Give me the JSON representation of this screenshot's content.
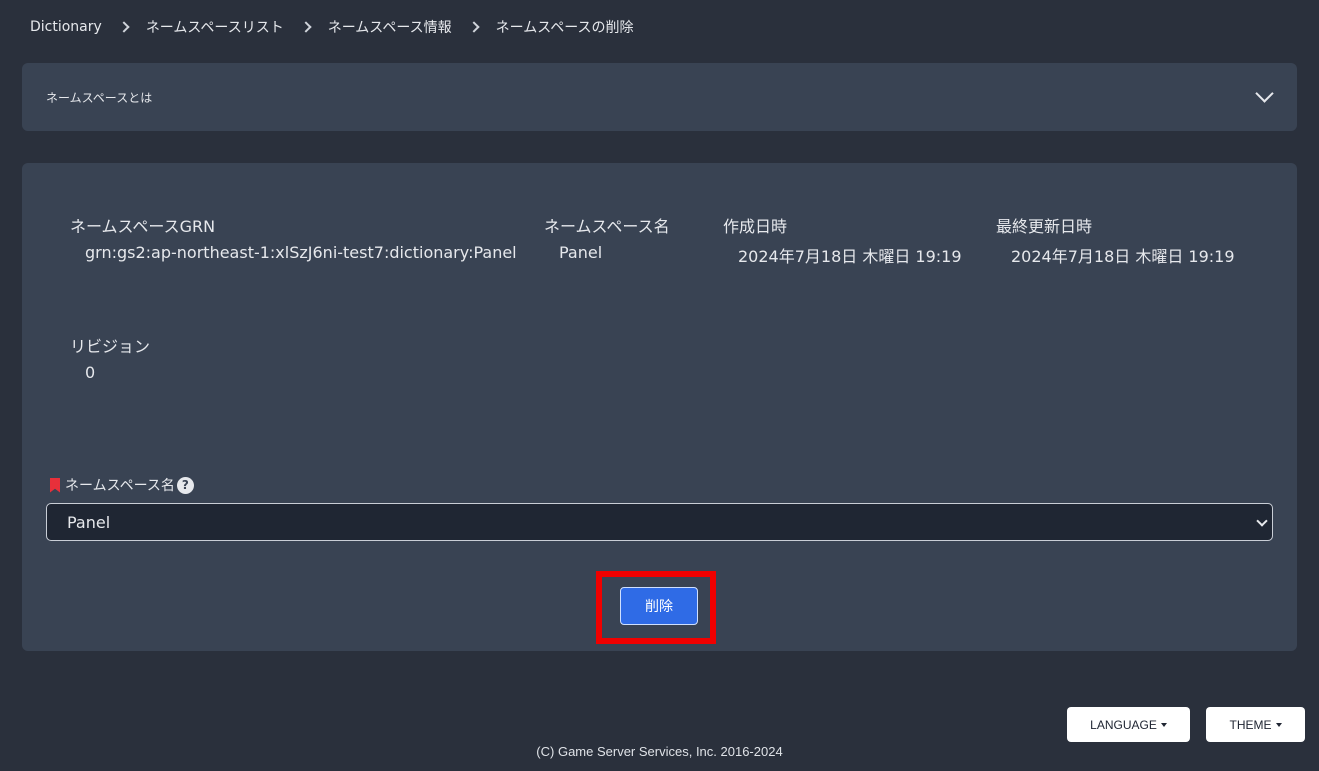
{
  "breadcrumb": {
    "items": [
      "Dictionary",
      "ネームスペースリスト",
      "ネームスペース情報",
      "ネームスペースの削除"
    ]
  },
  "about_panel": {
    "title": "ネームスペースとは",
    "expand_icon": "chevron-down-icon"
  },
  "details": {
    "grn_label": "ネームスペースGRN",
    "grn_value": "grn:gs2:ap-northeast-1:xlSzJ6ni-test7:dictionary:Panel",
    "name_label": "ネームスペース名",
    "name_value": "Panel",
    "created_label": "作成日時",
    "created_value": "2024年7月18日 木曜日 19:19",
    "updated_label": "最終更新日時",
    "updated_value": "2024年7月18日 木曜日 19:19",
    "revision_label": "リビジョン",
    "revision_value": "0"
  },
  "form": {
    "label": "ネームスペース名",
    "required_icon": "bookmark-icon",
    "help_icon": "?",
    "selected_value": "Panel",
    "delete_label": "削除"
  },
  "footer": {
    "language_label": "LANGUAGE",
    "theme_label": "THEME",
    "copyright": "(C) Game Server Services, Inc. 2016-2024"
  },
  "colors": {
    "background": "#2a303c",
    "card": "#394353",
    "primary_button": "#2f6be6",
    "highlight": "#f00000",
    "required": "#e8303a"
  }
}
